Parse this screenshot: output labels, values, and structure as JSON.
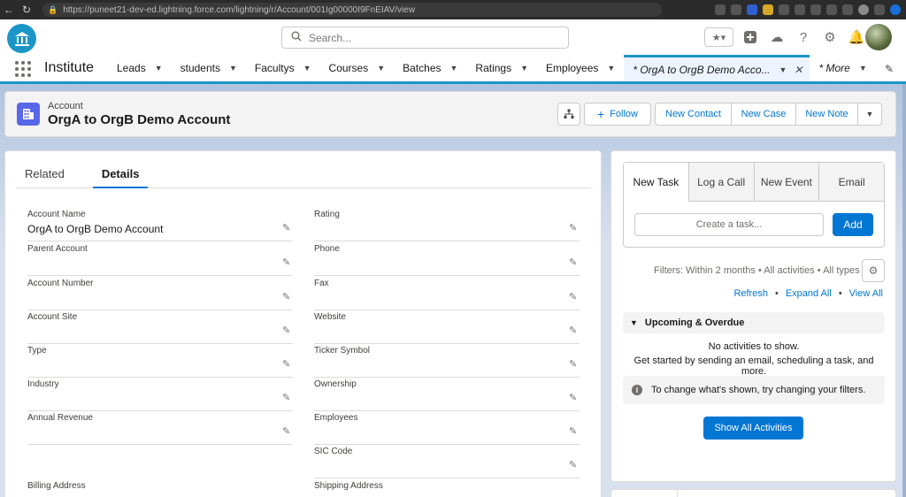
{
  "browser": {
    "url": "https://puneet21-dev-ed.lightning.force.com/lightning/r/Account/001Ig00000I9FnEIAV/view"
  },
  "header": {
    "search_placeholder": "Search..."
  },
  "nav": {
    "app_name": "Institute",
    "items": [
      {
        "label": "Leads"
      },
      {
        "label": "students"
      },
      {
        "label": "Facultys"
      },
      {
        "label": "Courses"
      },
      {
        "label": "Batches"
      },
      {
        "label": "Ratings"
      },
      {
        "label": "Employees"
      }
    ],
    "active_tab": "* OrgA to OrgB Demo Acco...",
    "more": "* More"
  },
  "record": {
    "type": "Account",
    "name": "OrgA to OrgB Demo Account",
    "actions": {
      "follow": "Follow",
      "new_contact": "New Contact",
      "new_case": "New Case",
      "new_note": "New Note"
    }
  },
  "tabs": {
    "related": "Related",
    "details": "Details"
  },
  "fields": {
    "left": [
      {
        "label": "Account Name",
        "value": "OrgA to OrgB Demo Account"
      },
      {
        "label": "Parent Account",
        "value": ""
      },
      {
        "label": "Account Number",
        "value": ""
      },
      {
        "label": "Account Site",
        "value": ""
      },
      {
        "label": "Type",
        "value": ""
      },
      {
        "label": "Industry",
        "value": ""
      },
      {
        "label": "Annual Revenue",
        "value": ""
      },
      {
        "label": "Billing Address",
        "value": ""
      }
    ],
    "right": [
      {
        "label": "Rating",
        "value": ""
      },
      {
        "label": "Phone",
        "value": ""
      },
      {
        "label": "Fax",
        "value": ""
      },
      {
        "label": "Website",
        "value": ""
      },
      {
        "label": "Ticker Symbol",
        "value": ""
      },
      {
        "label": "Ownership",
        "value": ""
      },
      {
        "label": "Employees",
        "value": ""
      },
      {
        "label": "SIC Code",
        "value": ""
      },
      {
        "label": "Shipping Address",
        "value": ""
      }
    ]
  },
  "activity": {
    "tabs": [
      "New Task",
      "Log a Call",
      "New Event",
      "Email"
    ],
    "task_placeholder": "Create a task...",
    "add_label": "Add",
    "filters": "Filters: Within 2 months • All activities • All types",
    "links": {
      "refresh": "Refresh",
      "expand_all": "Expand All",
      "view_all": "View All"
    },
    "upcoming_title": "Upcoming & Overdue",
    "no_activities": "No activities to show.",
    "get_started": "Get started by sending an email, scheduling a task, and more.",
    "filter_note": "To change what's shown, try changing your filters.",
    "show_all": "Show All Activities"
  },
  "colors": {
    "brand": "#0176d3",
    "nav_accent": "#1b96c6",
    "record_icon": "#5867e8"
  }
}
